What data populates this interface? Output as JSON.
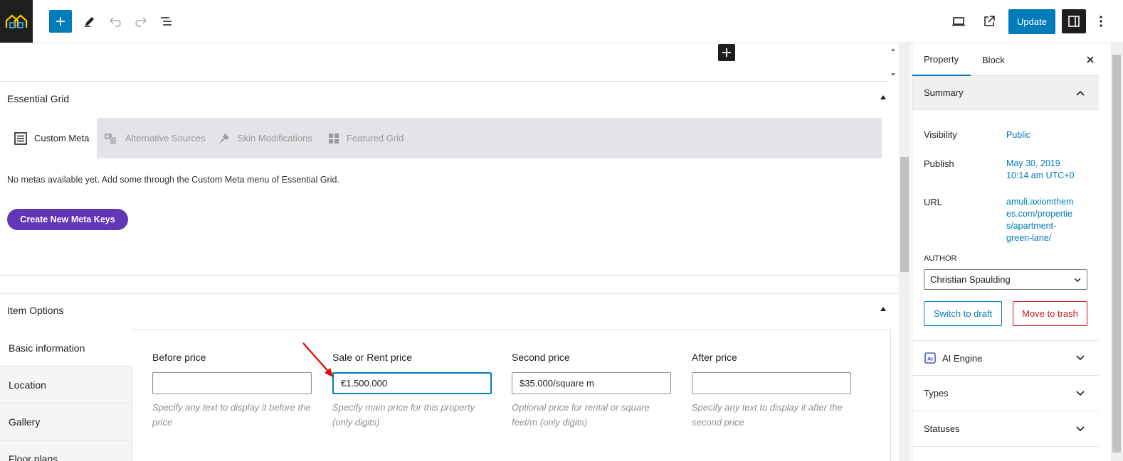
{
  "toolbar": {
    "update_label": "Update"
  },
  "essential_grid": {
    "title": "Essential Grid",
    "tabs": [
      {
        "label": "Custom Meta",
        "icon": "list-icon"
      },
      {
        "label": "Alternative Sources",
        "icon": "sources-icon"
      },
      {
        "label": "Skin Modifications",
        "icon": "brush-icon"
      },
      {
        "label": "Featured Grid",
        "icon": "grid-icon"
      }
    ],
    "note": "No metas available yet. Add some through the Custom Meta menu of Essential Grid.",
    "create_button": "Create New Meta Keys"
  },
  "item_options": {
    "title": "Item Options",
    "tabs": [
      "Basic information",
      "Location",
      "Gallery",
      "Floor plans"
    ],
    "fields": [
      {
        "label": "Before price",
        "value": "",
        "help": "Specify any text to display it before the price"
      },
      {
        "label": "Sale or Rent price",
        "value": "€1.500.000",
        "help": "Specify main price for this property (only digits)"
      },
      {
        "label": "Second price",
        "value": "$35.000/square m",
        "help": "Optional price for rental or square feet/m (only digits)"
      },
      {
        "label": "After price",
        "value": "",
        "help": "Specify any text to display it after the second price"
      }
    ]
  },
  "sidebar": {
    "tabs": [
      "Property",
      "Block"
    ],
    "summary_title": "Summary",
    "visibility_label": "Visibility",
    "visibility_value": "Public",
    "publish_label": "Publish",
    "publish_value_line1": "May 30, 2019",
    "publish_value_line2": "10:14 am UTC+0",
    "url_label": "URL",
    "url_value_lines": [
      "amuli.axiomthem",
      "es.com/propertie",
      "s/apartment-",
      "green-lane/"
    ],
    "author_label": "AUTHOR",
    "author_value": "Christian Spaulding",
    "switch_draft": "Switch to draft",
    "move_trash": "Move to trash",
    "panels": [
      "AI Engine",
      "Types",
      "Statuses"
    ]
  }
}
